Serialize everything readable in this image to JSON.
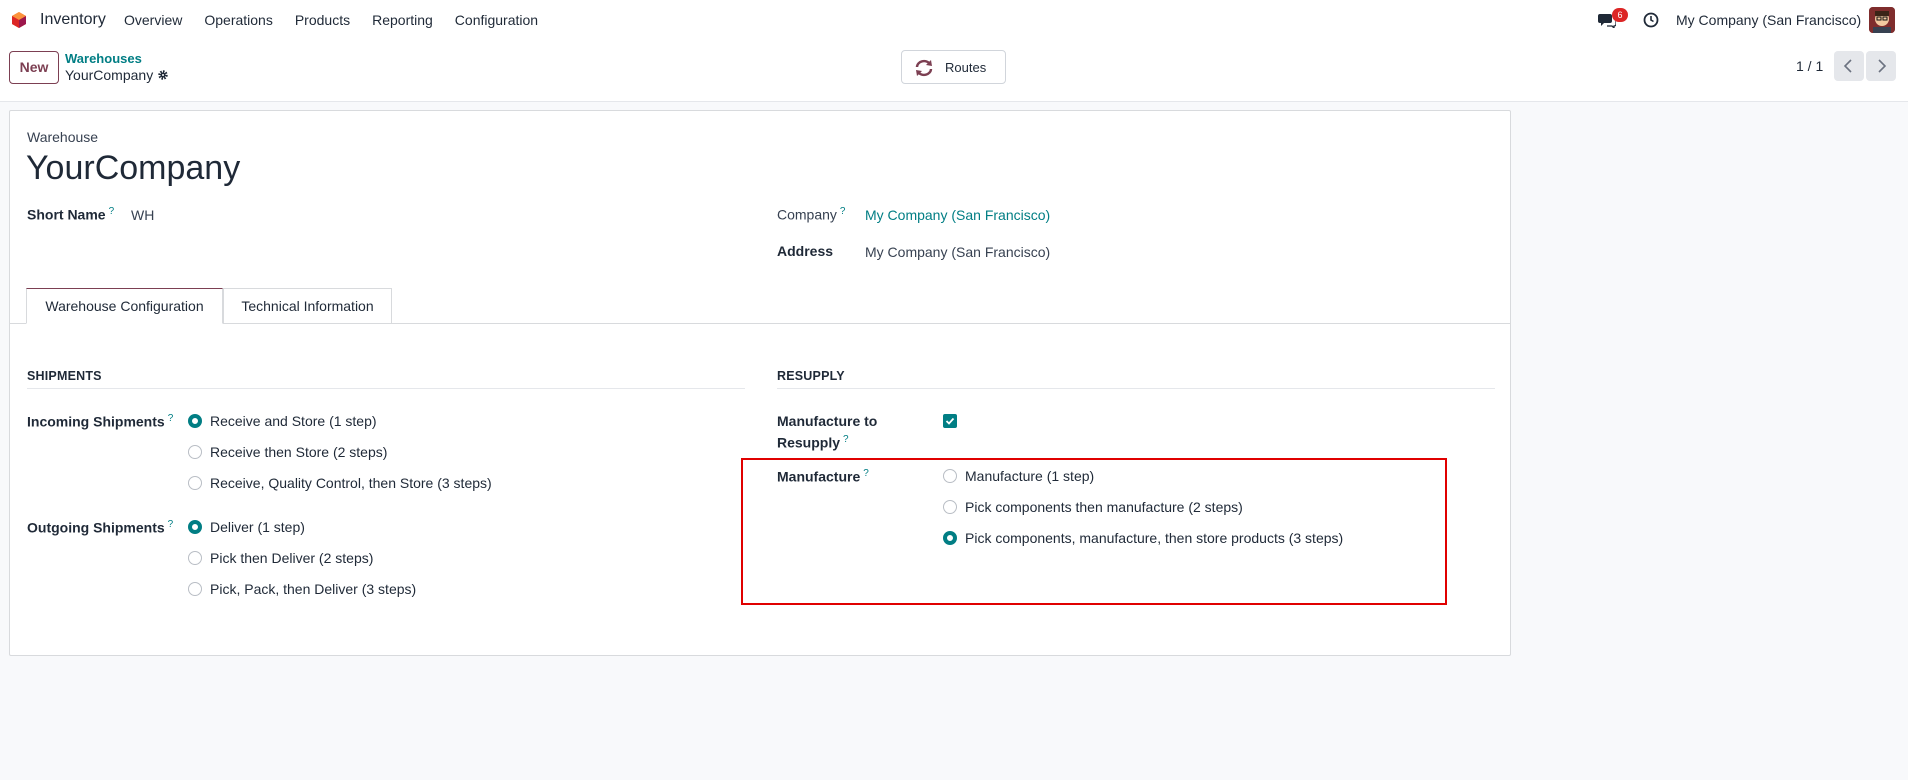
{
  "navbar": {
    "app_name": "Inventory",
    "menu": [
      "Overview",
      "Operations",
      "Products",
      "Reporting",
      "Configuration"
    ],
    "chat_count": "6",
    "company": "My Company (San Francisco)"
  },
  "control_panel": {
    "new_label": "New",
    "breadcrumb_parent": "Warehouses",
    "breadcrumb_current": "YourCompany",
    "routes_label": "Routes",
    "pager": "1 / 1"
  },
  "form": {
    "record_label": "Warehouse",
    "title": "YourCompany",
    "short_name_label": "Short Name",
    "short_name_help": "?",
    "short_name_value": "WH",
    "company_label": "Company",
    "company_help": "?",
    "company_value": "My Company (San Francisco)",
    "address_label": "Address",
    "address_value": "My Company (San Francisco)"
  },
  "tabs": [
    "Warehouse Configuration",
    "Technical Information"
  ],
  "shipments": {
    "title": "SHIPMENTS",
    "incoming_label": "Incoming Shipments",
    "incoming_help": "?",
    "incoming_options": [
      "Receive and Store (1 step)",
      "Receive then Store (2 steps)",
      "Receive, Quality Control, then Store (3 steps)"
    ],
    "incoming_selected": 0,
    "outgoing_label": "Outgoing Shipments",
    "outgoing_help": "?",
    "outgoing_options": [
      "Deliver (1 step)",
      "Pick then Deliver (2 steps)",
      "Pick, Pack, then Deliver (3 steps)"
    ],
    "outgoing_selected": 0
  },
  "resupply": {
    "title": "RESUPPLY",
    "manufacture_to_resupply_label_1": "Manufacture to",
    "manufacture_to_resupply_label_2": "Resupply",
    "manufacture_to_resupply_help": "?",
    "manufacture_to_resupply_checked": true,
    "manufacture_label": "Manufacture",
    "manufacture_help": "?",
    "manufacture_options": [
      "Manufacture (1 step)",
      "Pick components then manufacture (2 steps)",
      "Pick components, manufacture, then store products (3 steps)"
    ],
    "manufacture_selected": 2
  },
  "colors": {
    "brand": "#7c3f52",
    "accent": "#017e84",
    "highlight": "#e00000"
  }
}
